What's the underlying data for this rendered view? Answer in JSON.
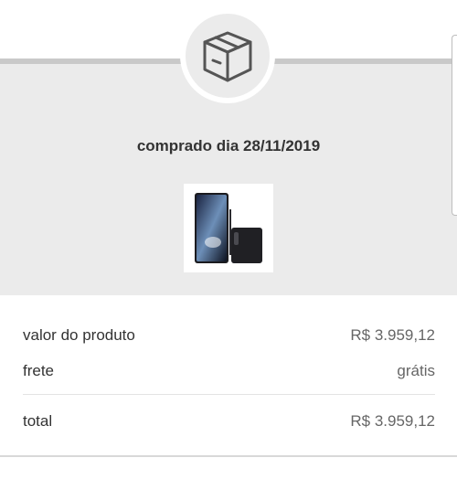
{
  "header": {
    "icon": "package-box-icon"
  },
  "purchase": {
    "date_text": "comprado dia 28/11/2019",
    "product_image": "smartphone-product-image"
  },
  "summary": {
    "product_label": "valor do produto",
    "product_value": "R$ 3.959,12",
    "shipping_label": "frete",
    "shipping_value": "grátis",
    "total_label": "total",
    "total_value": "R$ 3.959,12"
  },
  "colors": {
    "panel_background": "#ebebeb",
    "divider": "#c9c9c9",
    "text_primary": "#333333",
    "text_secondary": "#666666"
  }
}
